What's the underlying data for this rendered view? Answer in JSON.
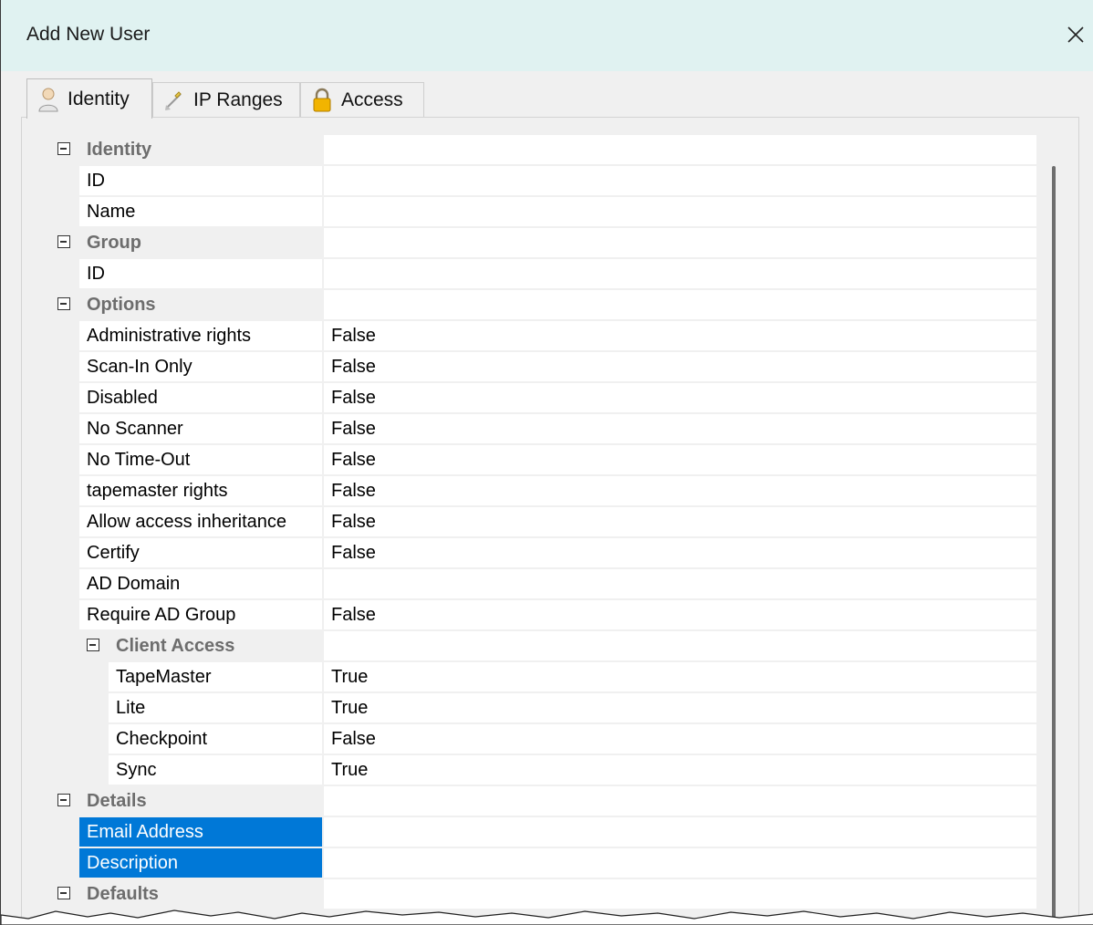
{
  "window": {
    "title": "Add New User"
  },
  "tabs": [
    {
      "label": "Identity",
      "icon": "user-icon",
      "active": true
    },
    {
      "label": "IP Ranges",
      "icon": "network-icon",
      "active": false
    },
    {
      "label": "Access",
      "icon": "lock-icon",
      "active": false
    }
  ],
  "property_grid": {
    "rows": [
      {
        "type": "category",
        "label": "Identity"
      },
      {
        "type": "property",
        "label": "ID",
        "value": ""
      },
      {
        "type": "property",
        "label": "Name",
        "value": ""
      },
      {
        "type": "category",
        "label": "Group"
      },
      {
        "type": "property",
        "label": "ID",
        "value": ""
      },
      {
        "type": "category",
        "label": "Options"
      },
      {
        "type": "property",
        "label": "Administrative rights",
        "value": "False"
      },
      {
        "type": "property",
        "label": "Scan-In Only",
        "value": "False"
      },
      {
        "type": "property",
        "label": "Disabled",
        "value": "False"
      },
      {
        "type": "property",
        "label": "No Scanner",
        "value": "False"
      },
      {
        "type": "property",
        "label": "No Time-Out",
        "value": "False"
      },
      {
        "type": "property",
        "label": "tapemaster rights",
        "value": "False"
      },
      {
        "type": "property",
        "label": "Allow access inheritance",
        "value": "False"
      },
      {
        "type": "property",
        "label": "Certify",
        "value": "False"
      },
      {
        "type": "property",
        "label": "AD Domain",
        "value": ""
      },
      {
        "type": "property",
        "label": "Require AD Group",
        "value": "False"
      },
      {
        "type": "subcategory",
        "label": "Client Access"
      },
      {
        "type": "subproperty",
        "label": "TapeMaster",
        "value": "True"
      },
      {
        "type": "subproperty",
        "label": "Lite",
        "value": "True"
      },
      {
        "type": "subproperty",
        "label": "Checkpoint",
        "value": "False"
      },
      {
        "type": "subproperty",
        "label": "Sync",
        "value": "True"
      },
      {
        "type": "category",
        "label": "Details"
      },
      {
        "type": "property",
        "label": "Email Address",
        "value": "",
        "selected": true
      },
      {
        "type": "property",
        "label": "Description",
        "value": "",
        "selected": true
      },
      {
        "type": "category",
        "label": "Defaults"
      }
    ]
  },
  "colors": {
    "titlebar": "#e0f2f1",
    "selection": "#0078d7",
    "category_text": "#6d6d6d"
  }
}
